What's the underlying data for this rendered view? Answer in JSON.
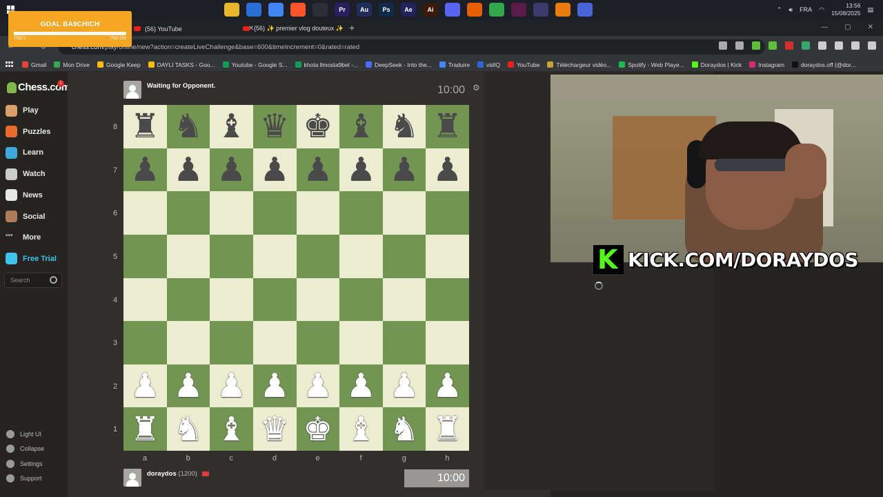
{
  "taskbar": {
    "language": "FRA",
    "time": "13:56",
    "date": "15/08/2025",
    "apps": [
      {
        "name": "file-explorer-icon",
        "color": "#e8b62c",
        "label": ""
      },
      {
        "name": "calendar-icon",
        "color": "#2a6fd6",
        "label": ""
      },
      {
        "name": "chrome-icon",
        "color": "#4285f4",
        "label": ""
      },
      {
        "name": "brave-icon",
        "color": "#fb542b",
        "label": ""
      },
      {
        "name": "obs-icon",
        "color": "#2b2e38",
        "label": ""
      },
      {
        "name": "premiere-icon",
        "color": "#2a1f5e",
        "label": "Pr"
      },
      {
        "name": "audition-icon",
        "color": "#1e2d5c",
        "label": "Au"
      },
      {
        "name": "photoshop-icon",
        "color": "#0f2a4a",
        "label": "Ps"
      },
      {
        "name": "after-effects-icon",
        "color": "#22235c",
        "label": "Ae"
      },
      {
        "name": "illustrator-icon",
        "color": "#3a1a08",
        "label": "Ai"
      },
      {
        "name": "discord-icon",
        "color": "#5865f2",
        "label": ""
      },
      {
        "name": "firefox-icon",
        "color": "#e66000",
        "label": ""
      },
      {
        "name": "chrome-canary-icon",
        "color": "#2fa74b",
        "label": ""
      },
      {
        "name": "vegas-icon",
        "color": "#5a1a4a",
        "label": ""
      },
      {
        "name": "stream-deck-icon",
        "color": "#3b3b6b",
        "label": ""
      },
      {
        "name": "blender-icon",
        "color": "#e87d0d",
        "label": ""
      },
      {
        "name": "dropbox-icon",
        "color": "#4a66d6",
        "label": ""
      }
    ]
  },
  "goal": {
    "title": "GOAL BA9CHICH",
    "min_label": "TND 0",
    "max_label": "TND 250",
    "progress": 0.01
  },
  "browser": {
    "tabs": [
      {
        "label": "(56) YouTube"
      },
      {
        "label": "(56) ✨ premier vlog douteux ✨"
      }
    ],
    "url_host": "chess.com",
    "url_path": "/play/online/new?action=createLiveChallenge&base=600&timeIncrement=0&rated=rated",
    "bookmarks": [
      {
        "label": "Gmail",
        "color": "#ea4335"
      },
      {
        "label": "Mon Drive",
        "color": "#34a853"
      },
      {
        "label": "Google Keep",
        "color": "#fbbc04"
      },
      {
        "label": "DAYLI TASKS - Goo...",
        "color": "#fbbc04"
      },
      {
        "label": "Youtube - Google S...",
        "color": "#0f9d58"
      },
      {
        "label": "khota llmosta9bel -...",
        "color": "#0f9d58"
      },
      {
        "label": "DeepSeek - Into the...",
        "color": "#4d6bfe"
      },
      {
        "label": "Traduire",
        "color": "#4285f4"
      },
      {
        "label": "vidIQ",
        "color": "#2d64d6"
      },
      {
        "label": "YouTube",
        "color": "#e62117"
      },
      {
        "label": "Téléchargeur vidéo...",
        "color": "#c9a13a"
      },
      {
        "label": "Spotify - Web Playe...",
        "color": "#1db954"
      },
      {
        "label": "Doraydos | Kick",
        "color": "#53fc18"
      },
      {
        "label": "Instagram",
        "color": "#d62976"
      },
      {
        "label": "doraydos.off (@dor...",
        "color": "#111111"
      }
    ]
  },
  "sidebar": {
    "logo": "Chess.com",
    "notification_count": "1",
    "items": [
      {
        "label": "Play",
        "color": "#d9a06b"
      },
      {
        "label": "Puzzles",
        "color": "#e86b2e"
      },
      {
        "label": "Learn",
        "color": "#3fa9dd"
      },
      {
        "label": "Watch",
        "color": "#cccccc"
      },
      {
        "label": "News",
        "color": "#e8e8e8"
      },
      {
        "label": "Social",
        "color": "#b07b57"
      },
      {
        "label": "More",
        "color": "#aaaaaa"
      },
      {
        "label": "Free Trial",
        "color": "#3fc3ee"
      }
    ],
    "search_placeholder": "Search",
    "bottom": [
      {
        "label": "Light UI"
      },
      {
        "label": "Collapse"
      },
      {
        "label": "Settings"
      },
      {
        "label": "Support"
      }
    ]
  },
  "game": {
    "opponent_status": "Waiting for Opponent.",
    "top_clock": "10:00",
    "bottom_clock": "10:00",
    "player_name": "doraydos",
    "player_rating": "(1200)",
    "ranks": [
      "8",
      "7",
      "6",
      "5",
      "4",
      "3",
      "2",
      "1"
    ],
    "files": [
      "a",
      "b",
      "c",
      "d",
      "e",
      "f",
      "g",
      "h"
    ],
    "position": [
      [
        "br",
        "bn",
        "bb",
        "bq",
        "bk",
        "bb",
        "bn",
        "br"
      ],
      [
        "bp",
        "bp",
        "bp",
        "bp",
        "bp",
        "bp",
        "bp",
        "bp"
      ],
      [
        "",
        "",
        "",
        "",
        "",
        "",
        "",
        ""
      ],
      [
        "",
        "",
        "",
        "",
        "",
        "",
        "",
        ""
      ],
      [
        "",
        "",
        "",
        "",
        "",
        "",
        "",
        ""
      ],
      [
        "",
        "",
        "",
        "",
        "",
        "",
        "",
        ""
      ],
      [
        "wp",
        "wp",
        "wp",
        "wp",
        "wp",
        "wp",
        "wp",
        "wp"
      ],
      [
        "wr",
        "wn",
        "wb",
        "wq",
        "wk",
        "wb",
        "wn",
        "wr"
      ]
    ]
  },
  "stream": {
    "kick_text": "KICK.COM/DORAYDOS"
  }
}
